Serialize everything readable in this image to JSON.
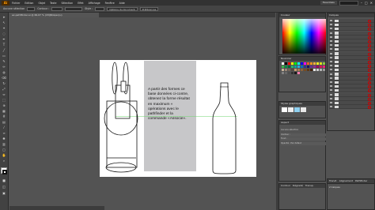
{
  "app": {
    "logo": "Ai"
  },
  "menubar": {
    "items": [
      "Fichier",
      "Edition",
      "Objet",
      "Texte",
      "Sélection",
      "Effet",
      "Affichage",
      "Fenêtre",
      "Aide"
    ],
    "workspace": "Essentiels"
  },
  "control_bar": {
    "label": "Aucune sélection",
    "stroke_label": "Contour :",
    "style_label": "Style :",
    "doc_button": "Options du document",
    "prefs_button": "Préférences"
  },
  "document_tab": "ex-pathfinder.ai @ 66,67 % (CMJN/Aperçu)",
  "artboard": {
    "instruction_text": "A partir des formes ce\nbase données ci-contre,\nobtenez la forme résultat\nen maximum «\nopérations avec le\npathfinder et la\ncommande «Associe»."
  },
  "panels": {
    "color_title": "Couleur",
    "swatches_title": "Nuancier",
    "symbols_title": "Styles graphiques",
    "layers_title": "Calques",
    "appearance_title": "Aspect",
    "appearance_rows": [
      "Aucune sélection",
      "Contour :",
      "Fond :",
      "Opacité : Par défaut"
    ],
    "bottom_tabs_left": [
      "Contour",
      "Dégradé",
      "Transp."
    ],
    "bottom_tabs_right": [
      "Transf.",
      "Alignement",
      "Pathfinder"
    ],
    "layers_footer": "2 Calques"
  },
  "colors": {
    "ui_dark": "#323232",
    "ui_mid": "#535353",
    "textbox_gray": "#c7c7c9",
    "guide_green": "#6dd66d",
    "accent_orange": "#ff9a00",
    "layer_dot": "#cc0000"
  },
  "swatch_colors": [
    "#ffffff",
    "#000000",
    "#ff0000",
    "#ffff00",
    "#00ff00",
    "#00ffff",
    "#0000ff",
    "#ff00ff",
    "#f15a24",
    "#f7931e",
    "#fbb03b",
    "#fcee21",
    "#d9e021",
    "#8cc63f",
    "#39b54a",
    "#009245",
    "#006837",
    "#22b573",
    "#00a99d",
    "#29abe2",
    "#0071bc",
    "#2e3192",
    "#1b1464",
    "#662d91",
    "#93278f",
    "#9e005d",
    "#d4145a",
    "#ed1e79",
    "#c7b299",
    "#998675",
    "#736357",
    "#534741",
    "#c69c6d",
    "#a67c52",
    "#8c6239",
    "#754c24",
    "#603813",
    "#42210b",
    "#e6e6e6",
    "#cccccc",
    "#b3b3b3",
    "#999999",
    "#808080",
    "#666666",
    "#4d4d4d",
    "#333333",
    "#1a1a1a",
    "#ff7bac"
  ]
}
